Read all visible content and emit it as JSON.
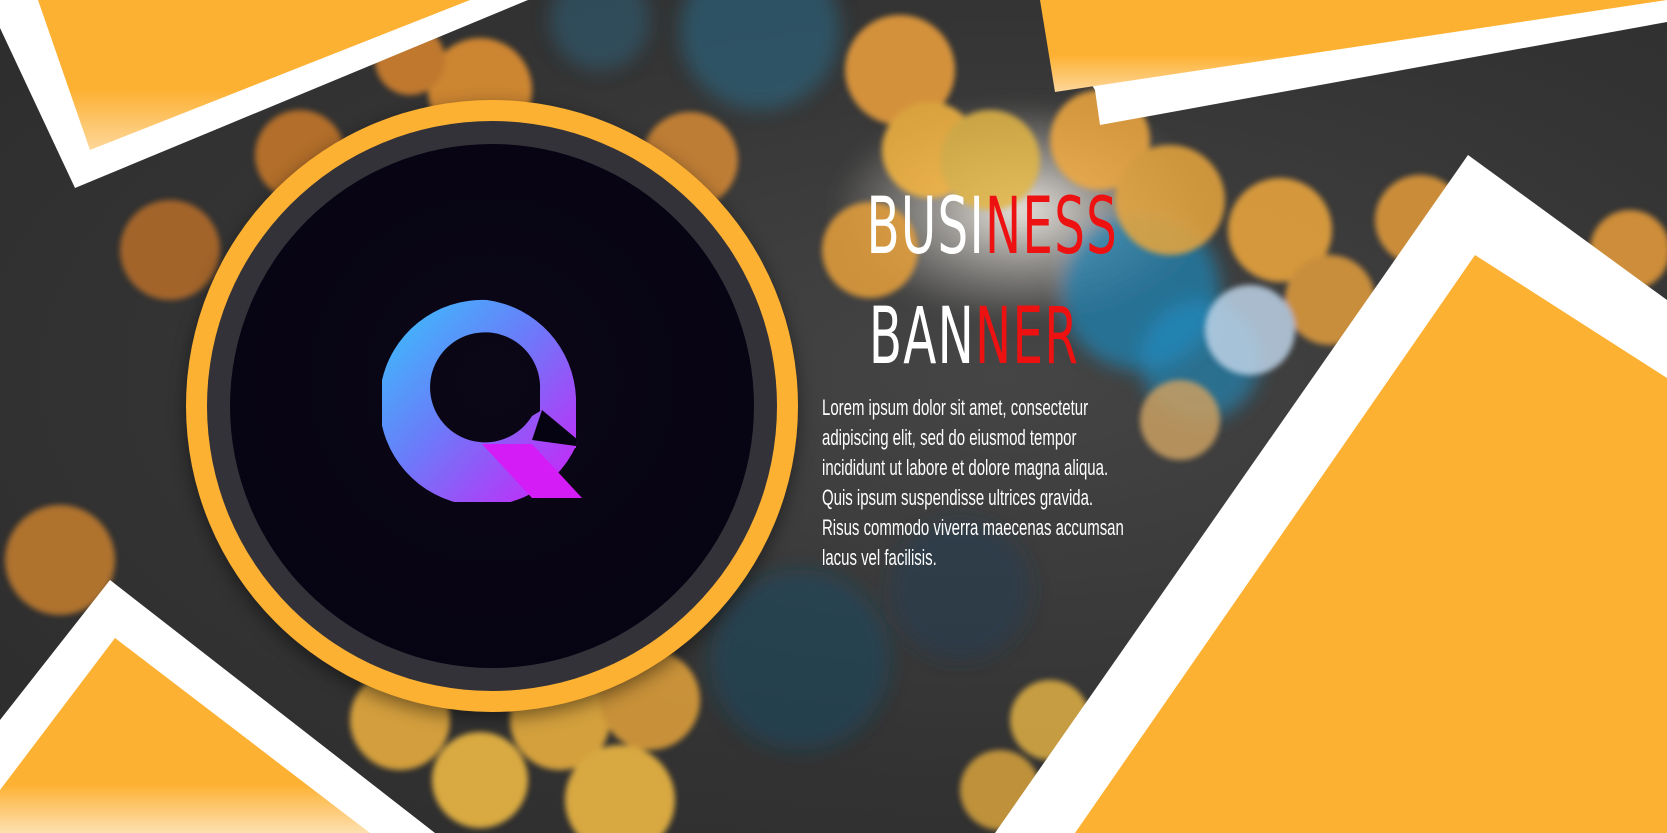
{
  "banner": {
    "headline": {
      "line1_white": "BUSI",
      "line1_red": "NESS",
      "line2_white": "BAN",
      "line2_red": "NER"
    },
    "body": "Lorem ipsum dolor sit amet, consectetur\nadipiscing elit, sed do eiusmod tempor\nincididunt ut labore et dolore magna aliqua.\nQuis ipsum suspendisse ultrices gravida.\nRisus commodo viverra maecenas accumsan\nlacus vel facilisis.",
    "logo": {
      "icon": "q-letter-logo-icon",
      "gradient_start": "#35c6fb",
      "gradient_end": "#d41cf7"
    }
  },
  "colors": {
    "accent_orange": "#fdb133",
    "headline_white": "#ffffff",
    "headline_red": "#ee1111",
    "background": "#333333",
    "emblem_core": "#050212"
  }
}
